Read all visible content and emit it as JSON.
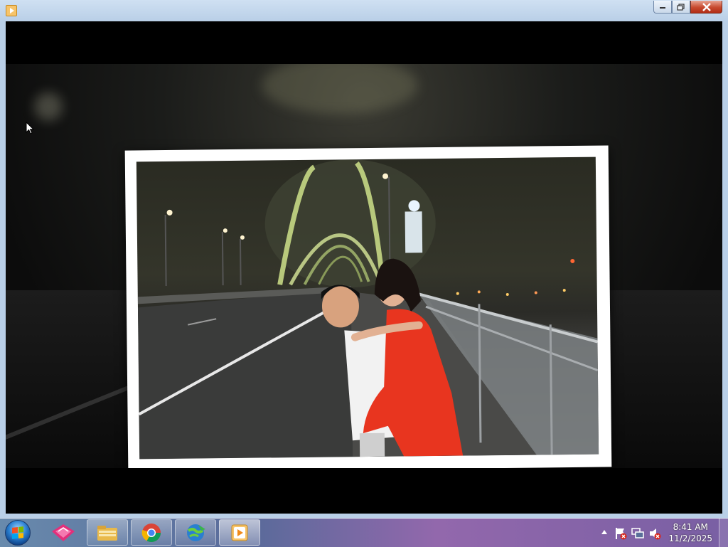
{
  "window": {
    "app_icon": "media-player-icon",
    "buttons": [
      "minimize-icon",
      "restore-icon",
      "close-icon"
    ]
  },
  "player": {
    "content": "photo-slideshow"
  },
  "taskbar": {
    "start": "windows-start-icon",
    "pinned": [
      {
        "name": "pink-app-icon",
        "active": false
      },
      {
        "name": "file-explorer-icon",
        "active": false
      },
      {
        "name": "chrome-browser-icon",
        "active": false
      },
      {
        "name": "globe-download-icon",
        "active": false
      },
      {
        "name": "media-player-icon",
        "active": true
      }
    ],
    "tray": [
      "show-hidden-icons",
      "action-center-flag-icon",
      "network-icon",
      "volume-muted-icon"
    ],
    "clock": {
      "time": "8:41 AM",
      "date": "11/2/2025"
    }
  },
  "colors": {
    "titlebar": "#c4d7ee",
    "close_button": "#c74a2f",
    "frame": "#ffffff",
    "dress": "#e8351f"
  }
}
